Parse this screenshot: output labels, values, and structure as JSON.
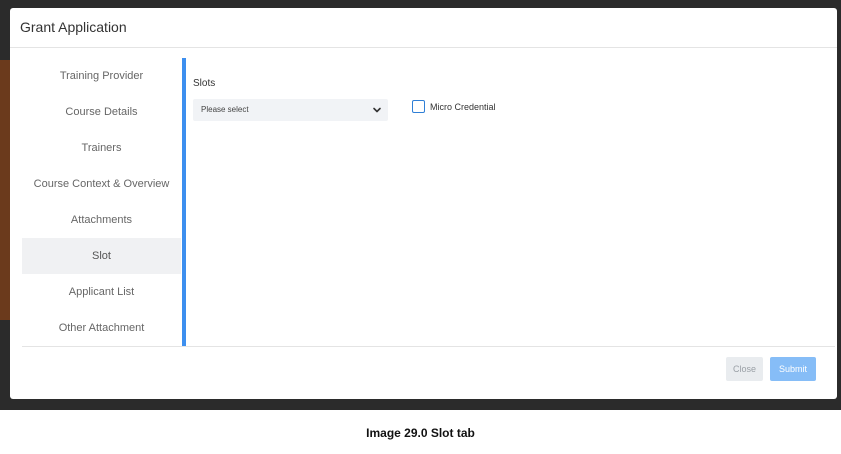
{
  "modal": {
    "title": "Grant Application"
  },
  "sidebar": {
    "tabs": [
      {
        "label": "Training Provider",
        "active": false
      },
      {
        "label": "Course Details",
        "active": false
      },
      {
        "label": "Trainers",
        "active": false
      },
      {
        "label": "Course Context & Overview",
        "active": false
      },
      {
        "label": "Attachments",
        "active": false
      },
      {
        "label": "Slot",
        "active": true
      },
      {
        "label": "Applicant List",
        "active": false
      },
      {
        "label": "Other Attachment",
        "active": false
      }
    ]
  },
  "content": {
    "slots_label": "Slots",
    "slots_select": {
      "value": "Please select",
      "icon": "chevron-down-icon"
    },
    "micro_credential": {
      "label": "Micro Credential",
      "checked": false
    }
  },
  "footer": {
    "close_label": "Close",
    "submit_label": "Submit"
  },
  "caption": "Image 29.0 Slot tab",
  "colors": {
    "accent": "#3d8fef",
    "submit": "#86bdf7",
    "active_tab_bg": "#f0f1f3"
  }
}
